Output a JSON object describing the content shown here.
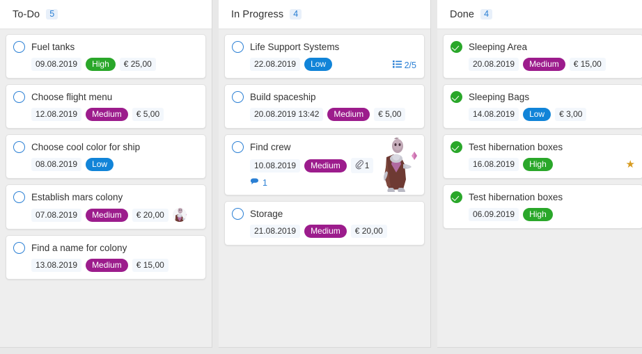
{
  "colors": {
    "board_bg": "#e8e8e8",
    "column_bg": "#eeeeee",
    "header_bg": "#ffffff",
    "card_bg": "#ffffff",
    "accent_blue": "#2a7fd4",
    "priority_high": "#2aa72a",
    "priority_medium": "#9c1c8c",
    "priority_low": "#1184d8",
    "star_gold": "#d79b21",
    "done_green": "#2aa72a"
  },
  "columns": [
    {
      "title": "To-Do",
      "count": "5",
      "cards": [
        {
          "status": "open",
          "title": "Fuel tanks",
          "date": "09.08.2019",
          "priority": "High",
          "priority_class": "high",
          "cost": "€ 25,00"
        },
        {
          "status": "open",
          "title": "Choose flight menu",
          "date": "12.08.2019",
          "priority": "Medium",
          "priority_class": "medium",
          "cost": "€ 5,00"
        },
        {
          "status": "open",
          "title": "Choose cool color for ship",
          "date": "08.08.2019",
          "priority": "Low",
          "priority_class": "low",
          "cost": ""
        },
        {
          "status": "open",
          "title": "Establish mars colony",
          "date": "07.08.2019",
          "priority": "Medium",
          "priority_class": "medium",
          "cost": "€ 20,00",
          "avatar": true
        },
        {
          "status": "open",
          "title": "Find a name for colony",
          "date": "13.08.2019",
          "priority": "Medium",
          "priority_class": "medium",
          "cost": "€ 15,00"
        }
      ]
    },
    {
      "title": "In Progress",
      "count": "4",
      "cards": [
        {
          "status": "open",
          "title": "Life Support Systems",
          "date": "22.08.2019",
          "priority": "Low",
          "priority_class": "low",
          "cost": "",
          "checklist": "2/5"
        },
        {
          "status": "open",
          "title": "Build spaceship",
          "date": "20.08.2019 13:42",
          "priority": "Medium",
          "priority_class": "medium",
          "cost": "€ 5,00"
        },
        {
          "status": "open",
          "title": "Find crew",
          "date": "10.08.2019",
          "priority": "Medium",
          "priority_class": "medium",
          "cost": "",
          "attachments": "1",
          "comments": "1",
          "figure": true
        },
        {
          "status": "open",
          "title": "Storage",
          "date": "21.08.2019",
          "priority": "Medium",
          "priority_class": "medium",
          "cost": "€ 20,00"
        }
      ]
    },
    {
      "title": "Done",
      "count": "4",
      "cards": [
        {
          "status": "done",
          "title": "Sleeping Area",
          "date": "20.08.2019",
          "priority": "Medium",
          "priority_class": "medium",
          "cost": "€ 15,00"
        },
        {
          "status": "done",
          "title": "Sleeping Bags",
          "date": "14.08.2019",
          "priority": "Low",
          "priority_class": "low",
          "cost": "€ 3,00"
        },
        {
          "status": "done",
          "title": "Test hibernation boxes",
          "date": "16.08.2019",
          "priority": "High",
          "priority_class": "high",
          "cost": "",
          "starred": true
        },
        {
          "status": "done",
          "title": "Test hibernation boxes",
          "date": "06.09.2019",
          "priority": "High",
          "priority_class": "high",
          "cost": ""
        }
      ]
    }
  ]
}
